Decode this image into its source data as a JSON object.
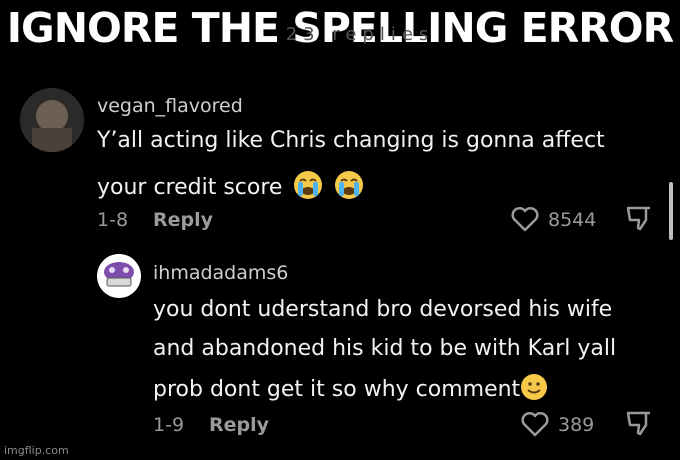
{
  "caption": "IGNORE THE SPELLING ERROR",
  "faded_header": "23 replies",
  "comments": [
    {
      "username": "vegan_flavored",
      "lines": [
        "Y’all acting like Chris changing is gonna affect",
        "your credit score"
      ],
      "emoji": [
        "loudly-crying-face",
        "loudly-crying-face"
      ],
      "date": "1-8",
      "reply_label": "Reply",
      "likes": "8544"
    },
    {
      "username": "ihmadadams6",
      "lines": [
        "you dont uderstand bro devorsed his wife",
        "and abandoned his kid to be with Karl yall",
        "prob dont get it so why comment"
      ],
      "emoji": [
        "slightly-smiling-face"
      ],
      "date": "1-9",
      "reply_label": "Reply",
      "likes": "389"
    }
  ],
  "watermark": "imgflip.com",
  "colors": {
    "background": "#000000",
    "text": "#f2f2f2",
    "muted": "#9a9a9a"
  }
}
